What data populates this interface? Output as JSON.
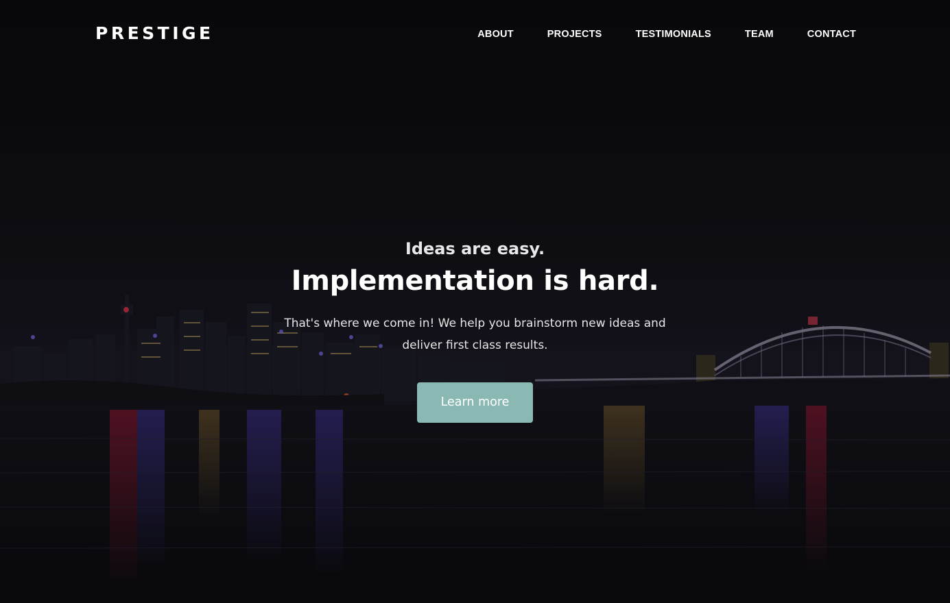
{
  "brand": {
    "logo_text": "PRESTIGE"
  },
  "nav": {
    "items": [
      {
        "label": "ABOUT"
      },
      {
        "label": "PROJECTS"
      },
      {
        "label": "TESTIMONIALS"
      },
      {
        "label": "TEAM"
      },
      {
        "label": "CONTACT"
      }
    ]
  },
  "hero": {
    "tagline": "Ideas are easy.",
    "headline": "Implementation is hard.",
    "subtitle": "That's where we come in! We help you brainstorm new ideas and deliver first class results.",
    "cta_label": "Learn more",
    "background_icon": "night-city-skyline-image"
  },
  "colors": {
    "background": "#0b0b0e",
    "cta": "#8ab9b4",
    "text": "#ffffff"
  }
}
